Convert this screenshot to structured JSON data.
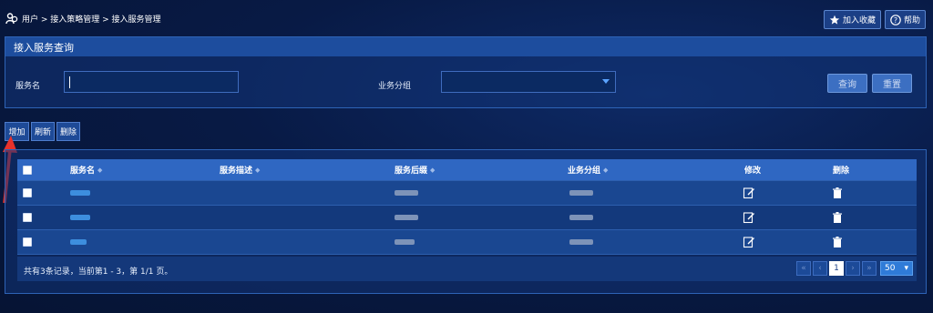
{
  "breadcrumb": {
    "text": "用户 > 接入策略管理 > 接入服务管理"
  },
  "top_buttons": {
    "favorite": "加入收藏",
    "help": "帮助"
  },
  "query": {
    "title": "接入服务查询",
    "service_name_label": "服务名",
    "service_name_value": "",
    "group_label": "业务分组",
    "group_value": "",
    "search_button": "查询",
    "reset_button": "重置"
  },
  "actions": {
    "add": "增加",
    "refresh": "刷新",
    "delete": "删除"
  },
  "table": {
    "columns": [
      "服务名",
      "服务描述",
      "服务后缀",
      "业务分组",
      "修改",
      "删除"
    ],
    "rows": [
      {
        "name": "",
        "desc": "",
        "suffix": "",
        "group": ""
      },
      {
        "name": "",
        "desc": "",
        "suffix": "",
        "group": ""
      },
      {
        "name": "",
        "desc": "",
        "suffix": "",
        "group": ""
      }
    ],
    "summary": "共有3条记录，当前第1 - 3，第 1/1 页。",
    "current_page": "1",
    "page_size": "50"
  },
  "colors": {
    "accent": "#2f67c2",
    "annotation": "#e8322b"
  }
}
